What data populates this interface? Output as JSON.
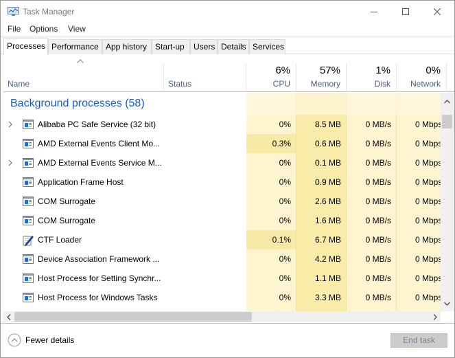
{
  "window": {
    "title": "Task Manager",
    "controls": {
      "minimize": "minimize-icon",
      "maximize": "maximize-icon",
      "close": "close-icon"
    }
  },
  "menu": [
    "File",
    "Options",
    "View"
  ],
  "tabs": [
    {
      "label": "Processes",
      "active": true
    },
    {
      "label": "Performance",
      "active": false
    },
    {
      "label": "App history",
      "active": false
    },
    {
      "label": "Start-up",
      "active": false
    },
    {
      "label": "Users",
      "active": false
    },
    {
      "label": "Details",
      "active": false
    },
    {
      "label": "Services",
      "active": false
    }
  ],
  "columns": {
    "name": {
      "label": "Name"
    },
    "status": {
      "label": "Status"
    },
    "cpu": {
      "label": "CPU",
      "percent": "6%"
    },
    "memory": {
      "label": "Memory",
      "percent": "57%"
    },
    "disk": {
      "label": "Disk",
      "percent": "1%"
    },
    "network": {
      "label": "Network",
      "percent": "0%"
    }
  },
  "group": {
    "title": "Background processes (58)"
  },
  "processes": [
    {
      "name": "Alibaba PC Safe Service (32 bit)",
      "expandable": true,
      "icon": "app-window-icon",
      "status": "",
      "cpu": "0%",
      "memory": "8.5 MB",
      "disk": "0 MB/s",
      "network": "0 Mbps"
    },
    {
      "name": "AMD External Events Client Mo...",
      "expandable": false,
      "icon": "app-window-icon",
      "status": "",
      "cpu": "0.3%",
      "memory": "0.6 MB",
      "disk": "0 MB/s",
      "network": "0 Mbps"
    },
    {
      "name": "AMD External Events Service M...",
      "expandable": true,
      "icon": "app-window-icon",
      "status": "",
      "cpu": "0%",
      "memory": "0.1 MB",
      "disk": "0 MB/s",
      "network": "0 Mbps"
    },
    {
      "name": "Application Frame Host",
      "expandable": false,
      "icon": "app-window-icon",
      "status": "",
      "cpu": "0%",
      "memory": "0.9 MB",
      "disk": "0 MB/s",
      "network": "0 Mbps"
    },
    {
      "name": "COM Surrogate",
      "expandable": false,
      "icon": "app-window-icon",
      "status": "",
      "cpu": "0%",
      "memory": "2.6 MB",
      "disk": "0 MB/s",
      "network": "0 Mbps"
    },
    {
      "name": "COM Surrogate",
      "expandable": false,
      "icon": "app-window-icon",
      "status": "",
      "cpu": "0%",
      "memory": "1.6 MB",
      "disk": "0 MB/s",
      "network": "0 Mbps"
    },
    {
      "name": "CTF Loader",
      "expandable": false,
      "icon": "pen-notepad-icon",
      "status": "",
      "cpu": "0.1%",
      "memory": "6.7 MB",
      "disk": "0 MB/s",
      "network": "0 Mbps"
    },
    {
      "name": "Device Association Framework ...",
      "expandable": false,
      "icon": "app-window-icon",
      "status": "",
      "cpu": "0%",
      "memory": "4.2 MB",
      "disk": "0 MB/s",
      "network": "0 Mbps"
    },
    {
      "name": "Host Process for Setting Synchr...",
      "expandable": false,
      "icon": "app-window-icon",
      "status": "",
      "cpu": "0%",
      "memory": "1.1 MB",
      "disk": "0 MB/s",
      "network": "0 Mbps"
    },
    {
      "name": "Host Process for Windows Tasks",
      "expandable": false,
      "icon": "app-window-icon",
      "status": "",
      "cpu": "0%",
      "memory": "3.3 MB",
      "disk": "0 MB/s",
      "network": "0 Mbps"
    }
  ],
  "footer": {
    "fewer_details": "Fewer details",
    "end_task": "End task"
  },
  "colors": {
    "group_title": "#1a5bbd",
    "header_label": "#4d6082",
    "heat_light": "#fff4d0",
    "heat_medium": "#f9eca8",
    "heat_cpu_active": "#f7e9a6",
    "col_border": "#eedfae"
  }
}
